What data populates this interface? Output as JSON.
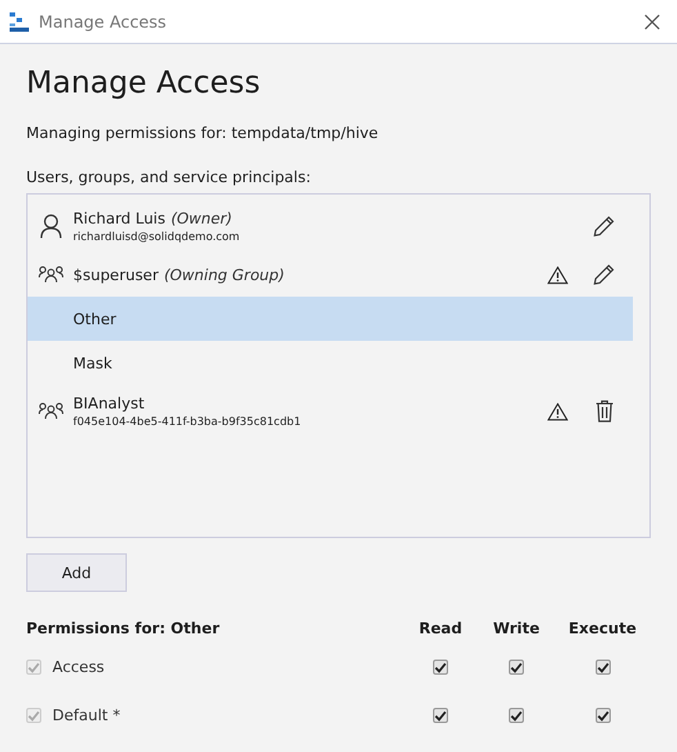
{
  "window": {
    "title": "Manage Access"
  },
  "heading": "Manage Access",
  "subtitle": "Managing permissions for: tempdata/tmp/hive",
  "list_label": "Users, groups, and service principals:",
  "principals": [
    {
      "kind": "user",
      "name": "Richard Luis",
      "role": "(Owner)",
      "detail": "richardluisd@solidqdemo.com",
      "warning": false,
      "editable": true,
      "deletable": false,
      "selected": false
    },
    {
      "kind": "group",
      "name": "$superuser",
      "role": "(Owning Group)",
      "warning": true,
      "editable": true,
      "deletable": false,
      "selected": false
    },
    {
      "kind": "none",
      "name": "Other",
      "warning": false,
      "editable": false,
      "deletable": false,
      "selected": true
    },
    {
      "kind": "none",
      "name": "Mask",
      "warning": false,
      "editable": false,
      "deletable": false,
      "selected": false
    },
    {
      "kind": "group",
      "name": "BIAnalyst",
      "detail": "f045e104-4be5-411f-b3ba-b9f35c81cdb1",
      "warning": true,
      "editable": false,
      "deletable": true,
      "selected": false
    }
  ],
  "add_button": "Add",
  "permissions": {
    "title": "Permissions for: Other",
    "columns": [
      "Read",
      "Write",
      "Execute"
    ],
    "rows": [
      {
        "label": "Access",
        "checked": true,
        "disabled": true,
        "values": [
          {
            "checked": true
          },
          {
            "checked": true
          },
          {
            "checked": true
          }
        ]
      },
      {
        "label": "Default *",
        "checked": true,
        "disabled": true,
        "values": [
          {
            "checked": true
          },
          {
            "checked": true
          },
          {
            "checked": true
          }
        ]
      }
    ]
  }
}
